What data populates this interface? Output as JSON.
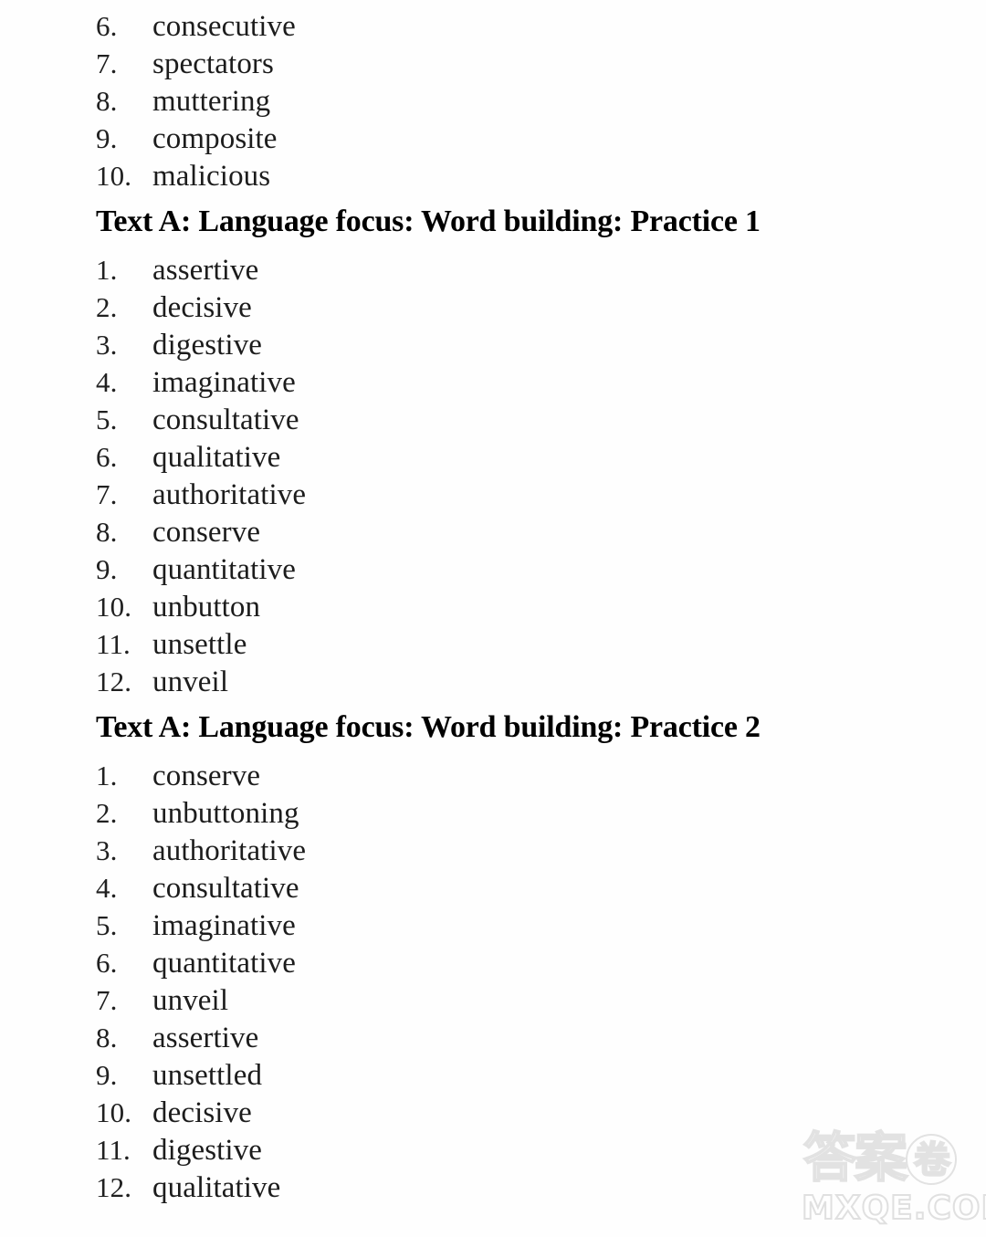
{
  "page": {
    "background_color": "#fefefe",
    "text_color": "#1a1a1a"
  },
  "sections": [
    {
      "heading": null,
      "items": [
        {
          "number": "6.",
          "word": "consecutive"
        },
        {
          "number": "7.",
          "word": "spectators"
        },
        {
          "number": "8.",
          "word": "muttering"
        },
        {
          "number": "9.",
          "word": "composite"
        },
        {
          "number": "10.",
          "word": "malicious"
        }
      ]
    },
    {
      "heading": "Text A: Language focus: Word building: Practice 1",
      "items": [
        {
          "number": "1.",
          "word": "assertive"
        },
        {
          "number": "2.",
          "word": "decisive"
        },
        {
          "number": "3.",
          "word": "digestive"
        },
        {
          "number": "4.",
          "word": "imaginative"
        },
        {
          "number": "5.",
          "word": "consultative"
        },
        {
          "number": "6.",
          "word": "qualitative"
        },
        {
          "number": "7.",
          "word": "authoritative"
        },
        {
          "number": "8.",
          "word": "conserve"
        },
        {
          "number": "9.",
          "word": "quantitative"
        },
        {
          "number": "10.",
          "word": "unbutton"
        },
        {
          "number": "11.",
          "word": "unsettle"
        },
        {
          "number": "12.",
          "word": "unveil"
        }
      ]
    },
    {
      "heading": "Text A: Language focus: Word building: Practice 2",
      "items": [
        {
          "number": "1.",
          "word": "conserve"
        },
        {
          "number": "2.",
          "word": "unbuttoning"
        },
        {
          "number": "3.",
          "word": "authoritative"
        },
        {
          "number": "4.",
          "word": "consultative"
        },
        {
          "number": "5.",
          "word": "imaginative"
        },
        {
          "number": "6.",
          "word": "quantitative"
        },
        {
          "number": "7.",
          "word": "unveil"
        },
        {
          "number": "8.",
          "word": "assertive"
        },
        {
          "number": "9.",
          "word": "unsettled"
        },
        {
          "number": "10.",
          "word": "decisive"
        },
        {
          "number": "11.",
          "word": "digestive"
        },
        {
          "number": "12.",
          "word": "qualitative"
        }
      ]
    }
  ],
  "watermark": {
    "cjk_text": "答案",
    "cjk_circled": "卷",
    "domain_text": "MXQE.COM",
    "color": "#e2e2e2"
  }
}
